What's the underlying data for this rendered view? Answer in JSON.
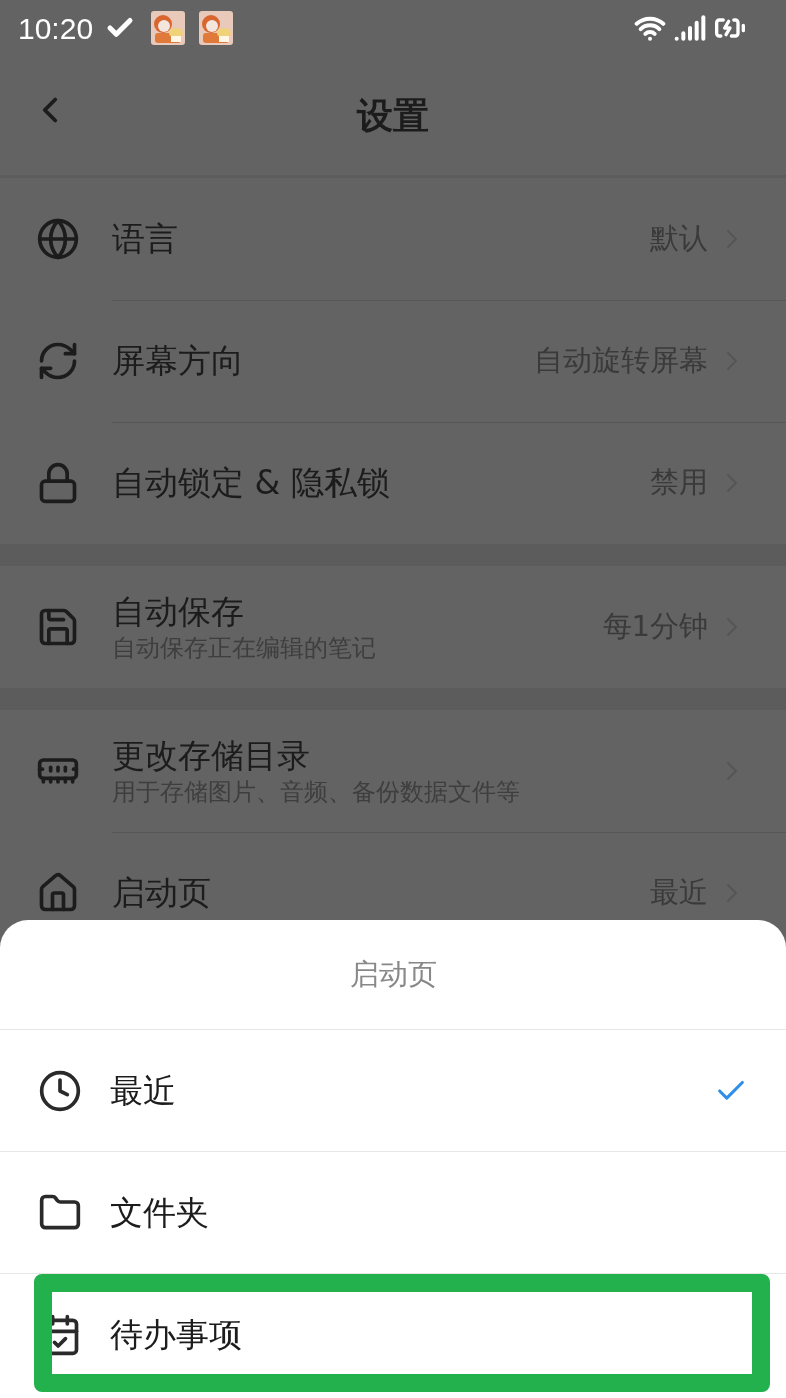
{
  "status_bar": {
    "time": "10:20"
  },
  "header": {
    "title": "设置"
  },
  "sections": [
    {
      "items": [
        {
          "title": "语言",
          "value": "默认"
        },
        {
          "title": "屏幕方向",
          "value": "自动旋转屏幕"
        },
        {
          "title": "自动锁定 & 隐私锁",
          "value": "禁用"
        }
      ]
    },
    {
      "items": [
        {
          "title": "自动保存",
          "subtitle": "自动保存正在编辑的笔记",
          "value": "每1分钟"
        }
      ]
    },
    {
      "items": [
        {
          "title": "更改存储目录",
          "subtitle": "用于存储图片、音频、备份数据文件等"
        },
        {
          "title": "启动页",
          "value": "最近"
        }
      ]
    }
  ],
  "sheet": {
    "title": "启动页",
    "options": [
      {
        "label": "最近",
        "selected": true,
        "highlighted": false
      },
      {
        "label": "文件夹",
        "selected": false,
        "highlighted": false
      },
      {
        "label": "待办事项",
        "selected": false,
        "highlighted": true
      }
    ]
  }
}
